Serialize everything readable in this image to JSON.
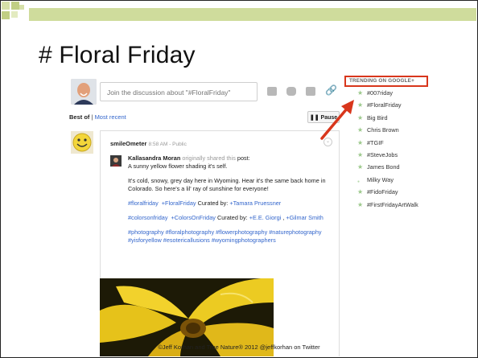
{
  "slide": {
    "title": "# Floral Friday",
    "footer": "©Jeff Korhan and True Nature® 2012    @jeffkorhan on Twitter"
  },
  "share": {
    "placeholder": "Join the discussion about \"#FloralFriday\""
  },
  "stream": {
    "best_label": "Best of",
    "recent_label": "Most recent",
    "pause_label": "Pause"
  },
  "post": {
    "author": "smileOmeter",
    "meta": "8:58 AM  -  Public",
    "original_author": "Kallasandra Moran",
    "originally_shared": "originally shared this",
    "post_word": "post",
    "line1": "A sunny yellow flower shading it's self.",
    "line2": "It's cold, snowy, grey day here in Wyoming. Hear it's the same back home in Colorado. So here's a lil' ray of sunshine for everyone!",
    "tag1": "#floralfriday",
    "tag2": "+FloralFriday",
    "curated_by": "Curated by:",
    "curator1": "+Tamara Pruessner",
    "tag3": "#colorsonfriday",
    "tag4": "+ColorsOnFriday",
    "curator2": "+E.E. Giorgi",
    "curator3": "+Gilmar Smith",
    "hashtags": "#photography  #floralphotography  #flowerphotography  #naturephotography  #yisforyellow  #esotericallusions  #wyomingphotographers"
  },
  "trending": {
    "title": "TRENDING ON GOOGLE+",
    "items": [
      "#007riday",
      "#FloralFriday",
      "Big Bird",
      "Chris Brown",
      "#TGIF",
      "#SteveJobs",
      "James Bond",
      "Milky Way",
      "#FidoFriday",
      "#FirstFridayArtWalk"
    ]
  },
  "colors": {
    "accent_bar": "#cfdc9c",
    "highlight": "#d8361c",
    "link": "#3366cc",
    "trend_star": "#9bc88a"
  }
}
